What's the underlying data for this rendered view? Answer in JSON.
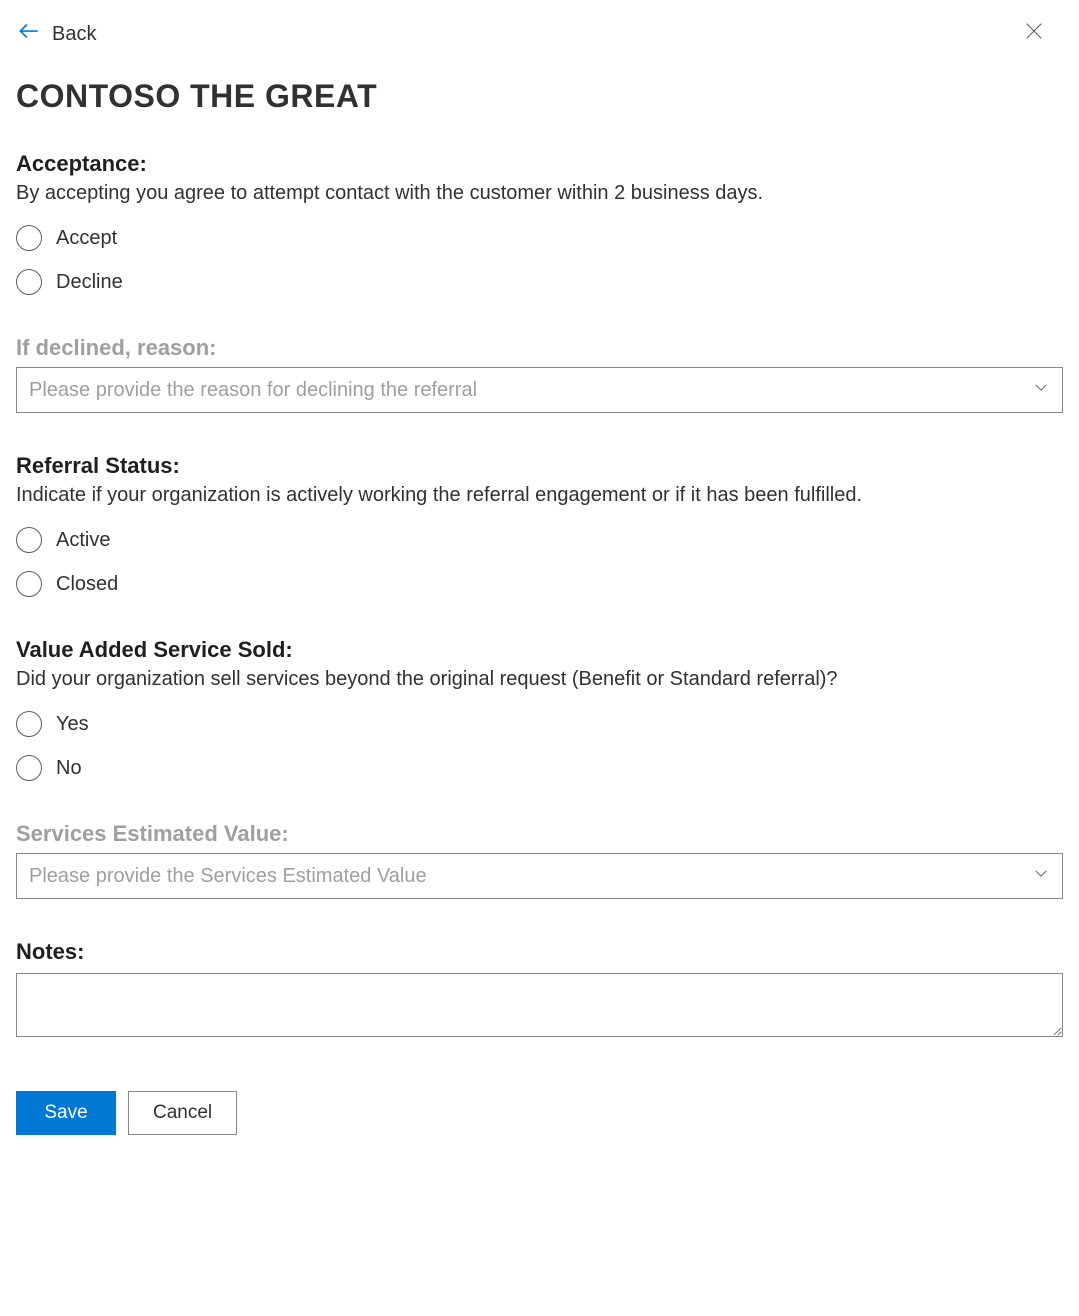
{
  "header": {
    "back_label": "Back",
    "title": "CONTOSO THE GREAT"
  },
  "acceptance": {
    "heading": "Acceptance:",
    "description": "By accepting you agree to attempt contact with the customer within 2 business days.",
    "options": {
      "accept": "Accept",
      "decline": "Decline"
    }
  },
  "decline_reason": {
    "label": "If declined, reason:",
    "placeholder": "Please provide the reason for declining the referral"
  },
  "referral_status": {
    "heading": "Referral Status:",
    "description": "Indicate if your organization is actively working the referral engagement or if it has been fulfilled.",
    "options": {
      "active": "Active",
      "closed": "Closed"
    }
  },
  "value_added": {
    "heading": "Value Added Service Sold:",
    "description": "Did your organization sell services beyond the original request (Benefit or Standard referral)?",
    "options": {
      "yes": "Yes",
      "no": "No"
    }
  },
  "services_value": {
    "label": "Services Estimated Value:",
    "placeholder": "Please provide the Services Estimated Value"
  },
  "notes": {
    "heading": "Notes:"
  },
  "buttons": {
    "save": "Save",
    "cancel": "Cancel"
  }
}
